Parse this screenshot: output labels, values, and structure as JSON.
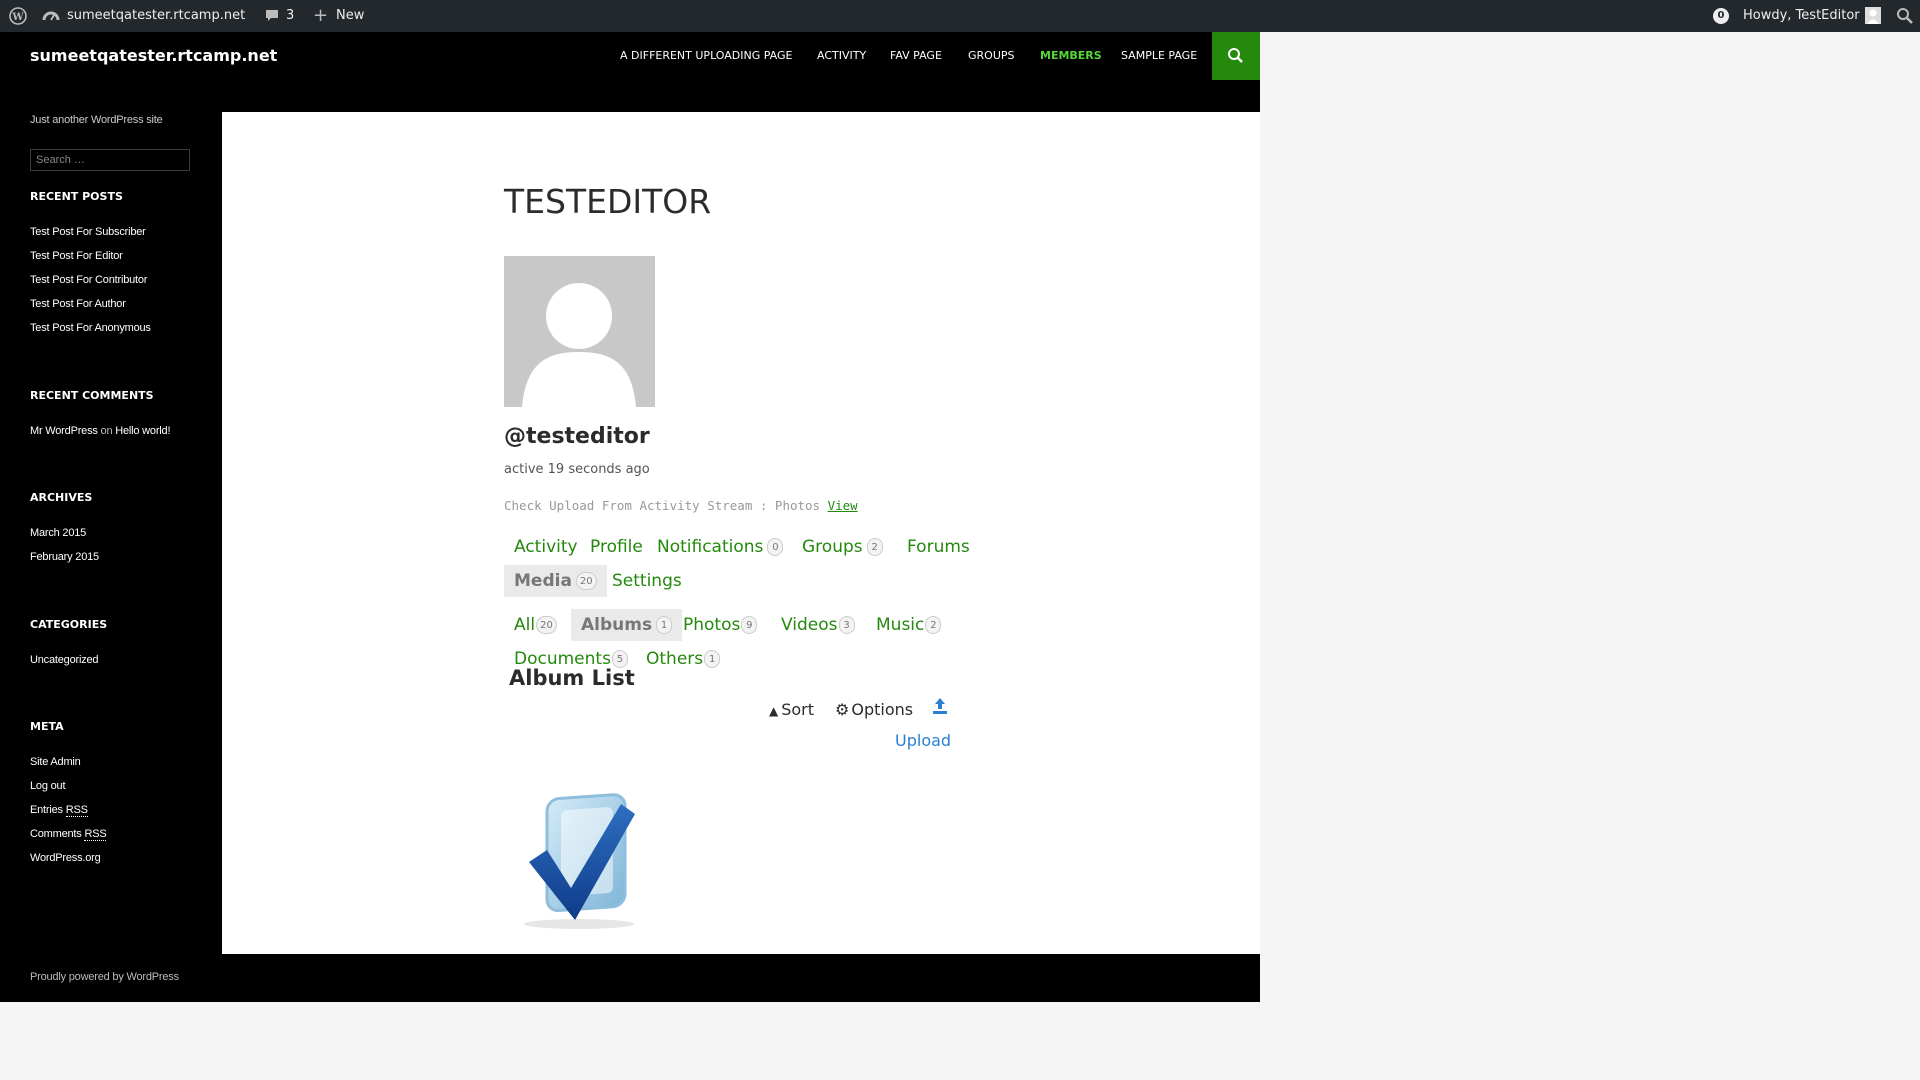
{
  "admin_bar": {
    "site_name": "sumeetqatester.rtcamp.net",
    "comments_count": "3",
    "new_label": "New",
    "notification_count": "0",
    "howdy": "Howdy, TestEditor"
  },
  "header": {
    "site_title": "sumeetqatester.rtcamp.net",
    "nav": [
      "A DIFFERENT UPLOADING PAGE",
      "ACTIVITY",
      "FAV PAGE",
      "GROUPS",
      "MEMBERS",
      "SAMPLE PAGE"
    ],
    "active_nav": "MEMBERS",
    "accent": "#24890d",
    "accent_light": "#55d737"
  },
  "sidebar": {
    "tagline": "Just another WordPress site",
    "search_placeholder": "Search …",
    "recent_posts_title": "RECENT POSTS",
    "recent_posts": [
      "Test Post For Subscriber",
      "Test Post For Editor",
      "Test Post For Contributor",
      "Test Post For Author",
      "Test Post For Anonymous"
    ],
    "recent_comments_title": "RECENT COMMENTS",
    "comment_author": "Mr WordPress",
    "comment_on": "on",
    "comment_post": "Hello world!",
    "archives_title": "ARCHIVES",
    "archives": [
      "March 2015",
      "February 2015"
    ],
    "categories_title": "CATEGORIES",
    "categories": [
      "Uncategorized"
    ],
    "meta_title": "META",
    "meta_site_admin": "Site Admin",
    "meta_log_out": "Log out",
    "meta_entries": "Entries",
    "meta_comments": "Comments",
    "meta_rss": "RSS",
    "meta_wordpress_org": "WordPress.org"
  },
  "main": {
    "page_title": "TESTEDITOR",
    "username": "@testeditor",
    "activity_time": "active 19 seconds ago",
    "latest_update": "Check Upload From Activity Stream : Photos",
    "view_link": "View",
    "member_nav": [
      {
        "label": "Activity",
        "count": ""
      },
      {
        "label": "Profile",
        "count": ""
      },
      {
        "label": "Notifications",
        "count": "0"
      },
      {
        "label": "Groups",
        "count": "2"
      },
      {
        "label": "Forums",
        "count": ""
      },
      {
        "label": "Media",
        "count": "20"
      },
      {
        "label": "Settings",
        "count": ""
      }
    ],
    "media_nav": [
      {
        "label": "All",
        "count": "20"
      },
      {
        "label": "Albums",
        "count": "1"
      },
      {
        "label": "Photos",
        "count": "9"
      },
      {
        "label": "Videos",
        "count": "3"
      },
      {
        "label": "Music",
        "count": "2"
      },
      {
        "label": "Documents",
        "count": "5"
      },
      {
        "label": "Others",
        "count": "1"
      }
    ],
    "album_list_title": "Album List",
    "sort_label": "Sort",
    "options_label": "Options",
    "upload_label": "Upload"
  },
  "footer": {
    "text": "Proudly powered by WordPress"
  }
}
